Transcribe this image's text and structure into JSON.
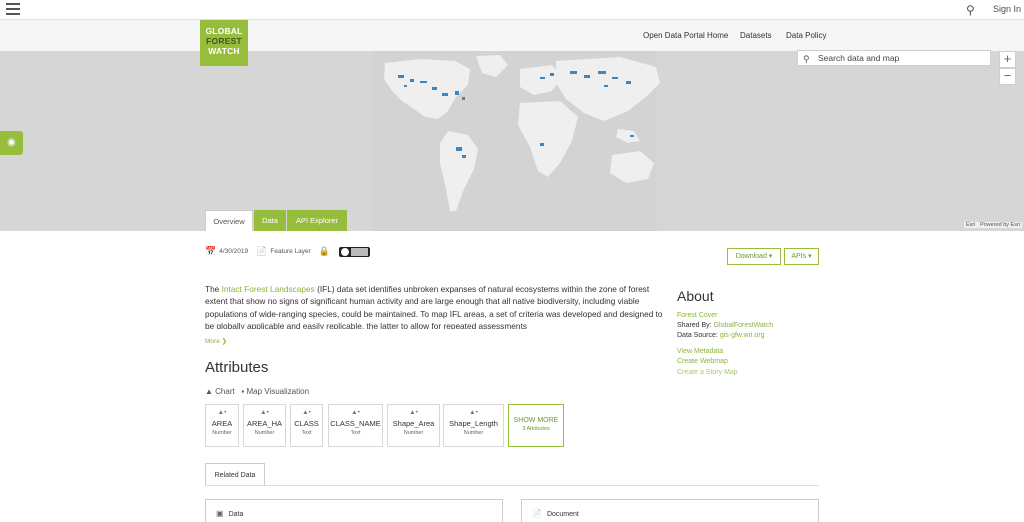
{
  "topbar": {
    "signin_label": "Sign In"
  },
  "logo": {
    "line1": "GLOBAL",
    "line2": "FOREST",
    "line3": "WATCH"
  },
  "header_nav": [
    "Open Data Portal Home",
    "Datasets",
    "Data Policy"
  ],
  "map": {
    "search_placeholder": "Search data and map",
    "zoom_in": "+",
    "zoom_out": "−",
    "attribution_left": "Esri",
    "attribution_right": "Powered by Esri"
  },
  "tabs": {
    "overview": "Overview",
    "data": "Data",
    "api": "API Explorer"
  },
  "meta": {
    "date": "4/30/2019",
    "type": "Feature Layer"
  },
  "actions": {
    "download": "Download ▾",
    "apis": "APIs ▾"
  },
  "description": {
    "prefix": "The ",
    "link": "Intact Forest Landscapes",
    "body": " (IFL) data set identifies unbroken expanses of natural ecosystems within the zone of forest extent that show no signs of significant human activity and are large enough that all native biodiversity, including viable populations of wide-ranging species, could be maintained. To map IFL areas, a set of criteria was developed and designed to be globally applicable and easily replicable, the latter to allow for repeated assessments",
    "more": "More ❯"
  },
  "about": {
    "title": "About",
    "category": "Forest Cover",
    "shared_prefix": "Shared By: ",
    "shared_by": "GlobalForestWatch",
    "source_prefix": "Data Source: ",
    "source": "gis-gfw.wri.org",
    "view_metadata": "View Metadata",
    "create_webmap": "Create Webmap",
    "create_story": "Create a Story Map"
  },
  "attributes": {
    "title": "Attributes",
    "mode_chart": "Chart",
    "mode_map": "Map Visualization",
    "items": [
      {
        "name": "AREA",
        "type": "Number"
      },
      {
        "name": "AREA_HA",
        "type": "Number"
      },
      {
        "name": "CLASS",
        "type": "Text"
      },
      {
        "name": "CLASS_NAME",
        "type": "Text"
      },
      {
        "name": "Shape_Area",
        "type": "Number"
      },
      {
        "name": "Shape_Length",
        "type": "Number"
      }
    ],
    "show_more": "SHOW MORE",
    "show_more_sub": "3 Attributes"
  },
  "related": {
    "tab": "Related Data",
    "data": "Data",
    "document": "Document"
  }
}
